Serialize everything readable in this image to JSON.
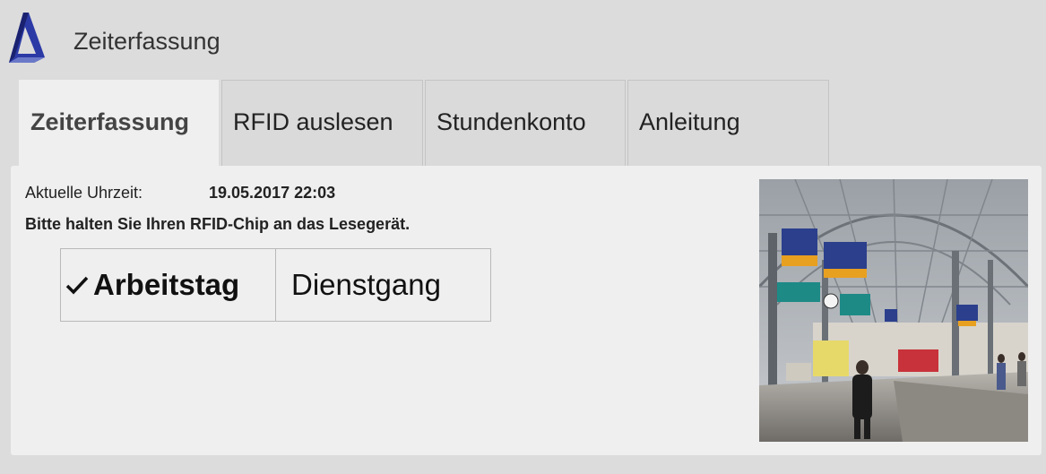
{
  "header": {
    "logo_icon": "triangle-logo-icon",
    "title": "Zeiterfassung"
  },
  "tabs": [
    {
      "label": "Zeiterfassung",
      "active": true
    },
    {
      "label": "RFID auslesen",
      "active": false
    },
    {
      "label": "Stundenkonto",
      "active": false
    },
    {
      "label": "Anleitung",
      "active": false
    }
  ],
  "clock": {
    "label": "Aktuelle Uhrzeit:",
    "value": "19.05.2017 22:03"
  },
  "instruction": "Bitte halten Sie Ihren RFID-Chip an das Lesegerät.",
  "mode": {
    "options": [
      {
        "label": "Arbeitstag",
        "selected": true,
        "icon": "checkmark-icon"
      },
      {
        "label": "Dienstgang",
        "selected": false
      }
    ]
  },
  "colors": {
    "background": "#dcdcdc",
    "panel": "#efefef",
    "logo": "#2a3aa0"
  }
}
